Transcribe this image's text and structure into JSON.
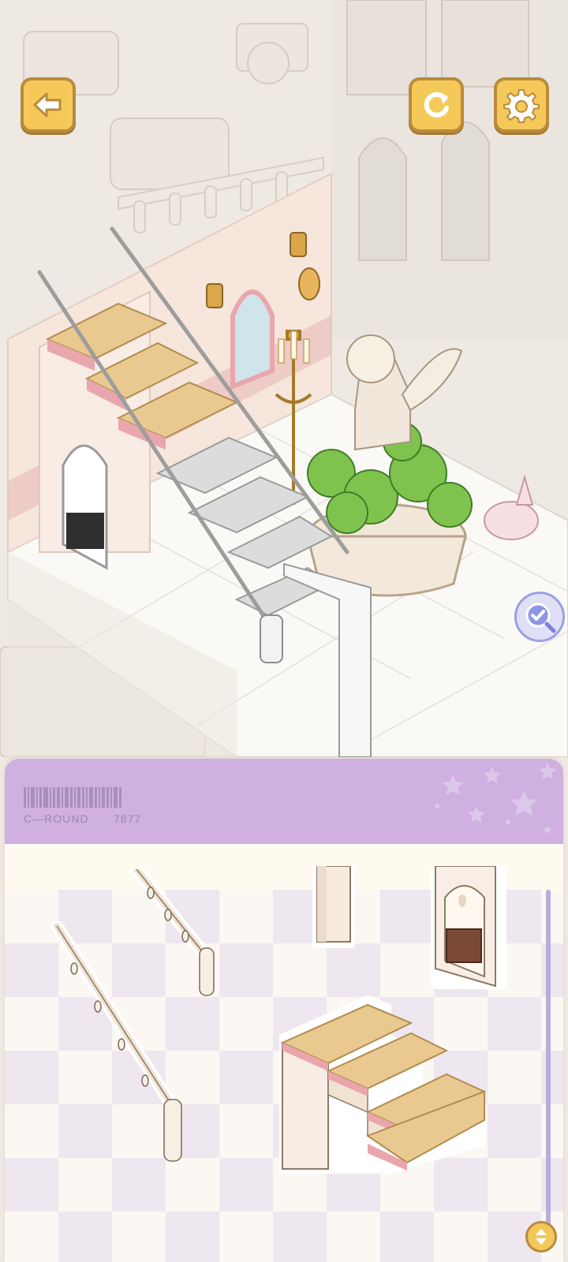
{
  "header": {
    "back_icon": "arrow-left-icon",
    "restart_icon": "refresh-icon",
    "settings_icon": "gear-icon"
  },
  "scene": {
    "zoom_icon": "magnifier-check-icon"
  },
  "panel": {
    "tag_label": "C—ROUND",
    "tag_number": "7877",
    "pieces": [
      {
        "name": "short-handrail-piece"
      },
      {
        "name": "long-handrail-piece"
      },
      {
        "name": "column-piece"
      },
      {
        "name": "archway-door-piece"
      },
      {
        "name": "carpet-stairs-piece"
      }
    ],
    "sort_icon": "swap-vertical-icon"
  },
  "colors": {
    "button_fill": "#f4c95a",
    "button_border": "#b98b3c",
    "panel_header": "#cfb0e0",
    "carpet": "#e9c98f",
    "step_edge": "#e9a6ad"
  }
}
